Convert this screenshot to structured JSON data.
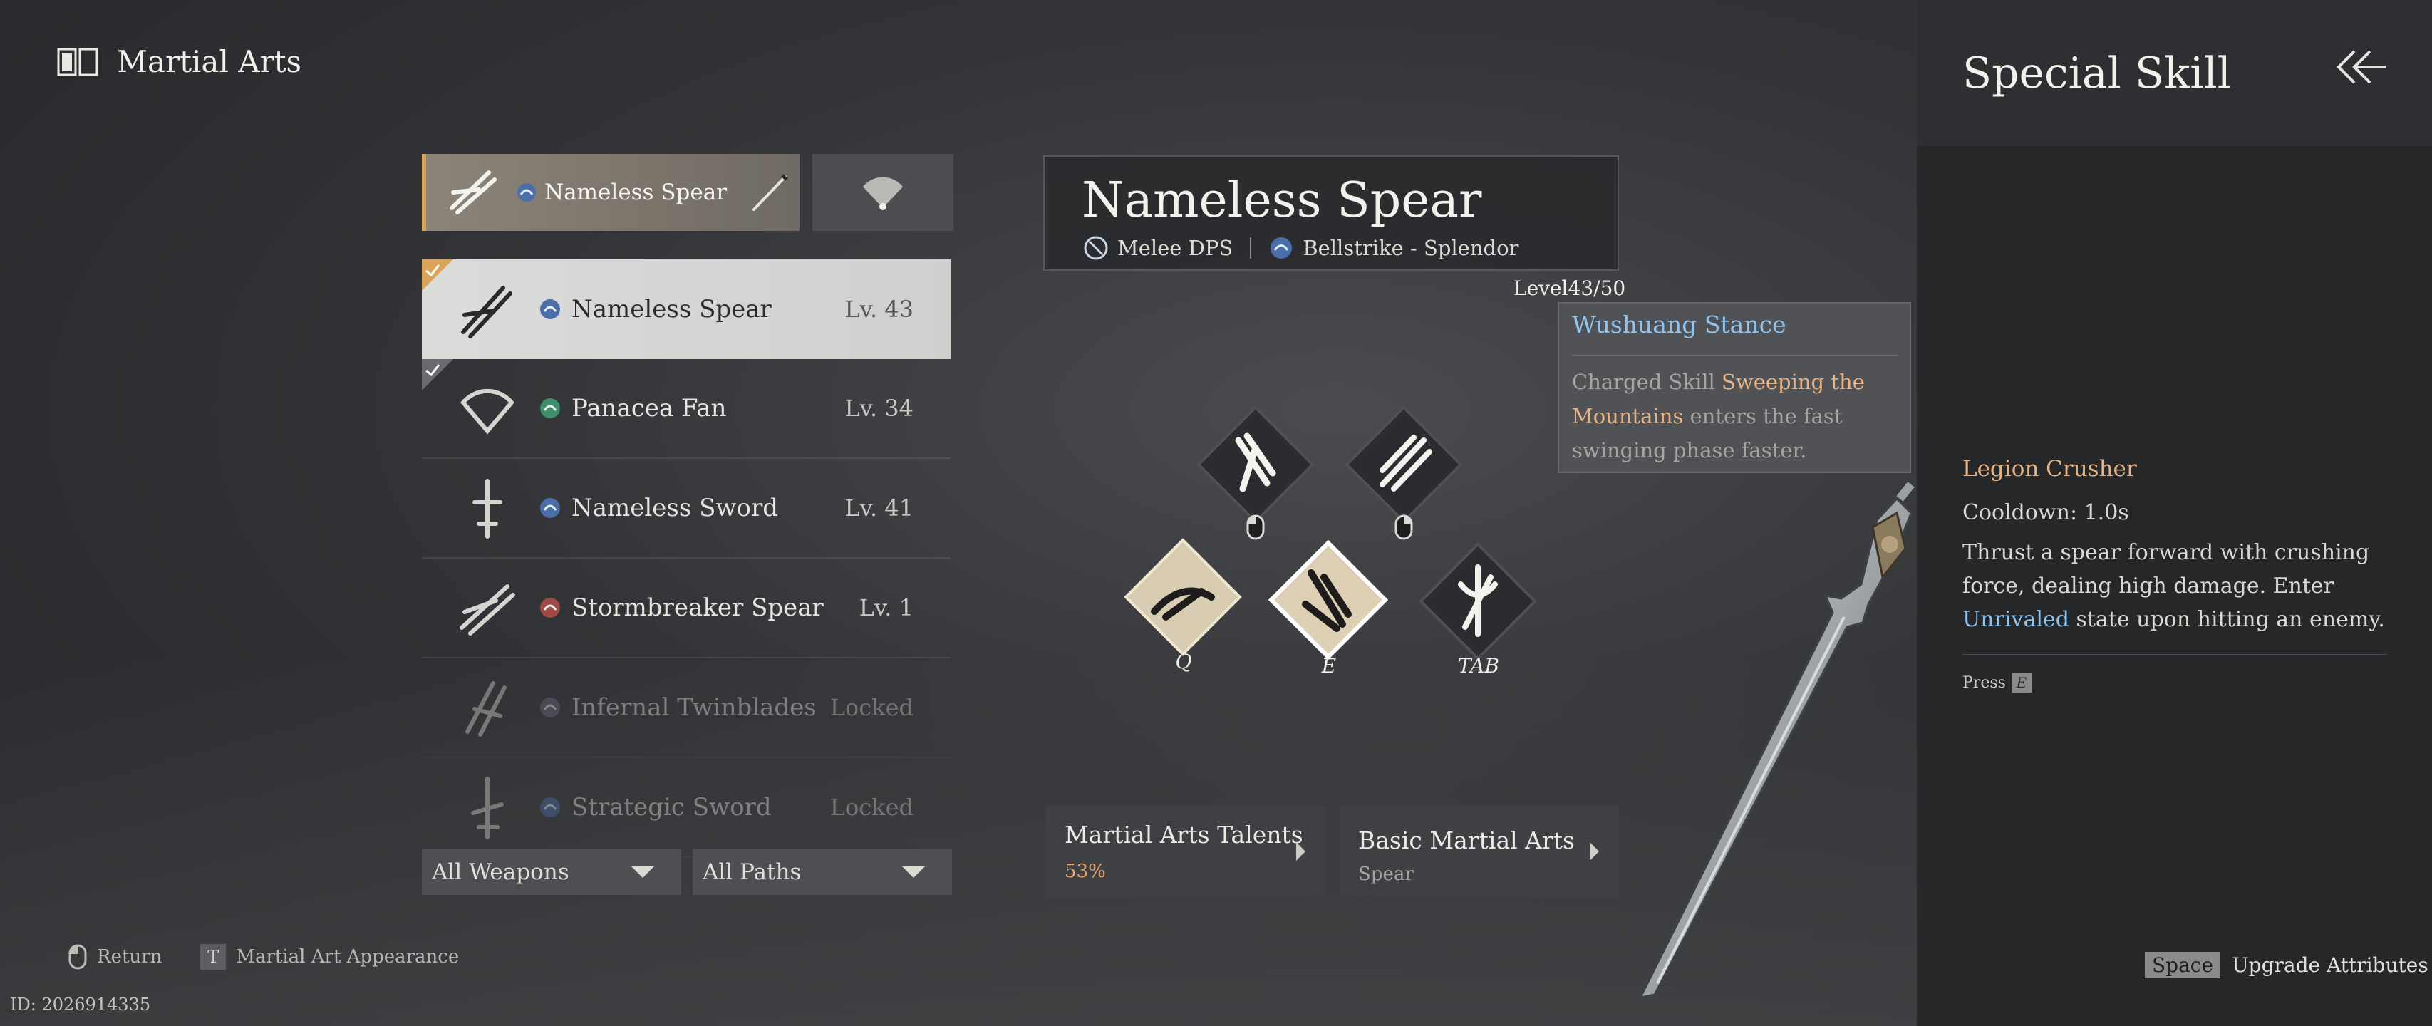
{
  "header": {
    "title": "Martial Arts",
    "icon": "book-icon"
  },
  "weapon_tabs": {
    "active": {
      "label": "Nameless Spear"
    }
  },
  "weapons": [
    {
      "name": "Nameless Spear",
      "level": "Lv. 43",
      "selected": true,
      "checked": true,
      "locked": false,
      "badge_color": "#4a6ea8"
    },
    {
      "name": "Panacea Fan",
      "level": "Lv. 34",
      "selected": false,
      "checked": true,
      "locked": false,
      "badge_color": "#3e8f6a"
    },
    {
      "name": "Nameless Sword",
      "level": "Lv. 41",
      "selected": false,
      "checked": false,
      "locked": false,
      "badge_color": "#4a6ea8"
    },
    {
      "name": "Stormbreaker Spear",
      "level": "Lv. 1",
      "selected": false,
      "checked": false,
      "locked": false,
      "badge_color": "#a04a44"
    },
    {
      "name": "Infernal Twinblades",
      "level": "Locked",
      "selected": false,
      "checked": false,
      "locked": true,
      "badge_color": "#6a6a80"
    },
    {
      "name": "Strategic Sword",
      "level": "Locked",
      "selected": false,
      "checked": false,
      "locked": true,
      "badge_color": "#4a6ea8"
    }
  ],
  "filters": {
    "weapons": "All Weapons",
    "paths": "All Paths"
  },
  "footer": {
    "return_label": "Return",
    "appearance_key": "T",
    "appearance_label": "Martial Art Appearance",
    "id": "ID: 2026914335"
  },
  "info": {
    "title": "Nameless Spear",
    "role": "Melee DPS",
    "path": "Bellstrike - Splendor",
    "level": "Level43/50"
  },
  "tooltip": {
    "title": "Wushuang Stance",
    "body_prefix": "Charged Skill ",
    "body_highlight": "Sweeping the Mountains",
    "body_suffix": " enters the fast swinging phase faster."
  },
  "skills": {
    "q": "Q",
    "e": "E",
    "tab": "TAB"
  },
  "cards": {
    "talents": {
      "title": "Martial Arts Talents",
      "sub": "53%"
    },
    "basic": {
      "title": "Basic Martial Arts",
      "sub": "Spear"
    }
  },
  "right_panel": {
    "title": "Special Skill",
    "skill_name": "Legion Crusher",
    "cooldown": "Cooldown: 1.0s",
    "desc_prefix": "Thrust a spear forward with crushing force, dealing high damage. Enter ",
    "desc_highlight": "Unrivaled",
    "desc_suffix": " state upon hitting an enemy.",
    "press_label": "Press",
    "press_key": "E",
    "upgrade_key": "Space",
    "upgrade_label": "Upgrade Attributes"
  },
  "colors": {
    "accent": "#d9a45a",
    "highlight_orange": "#e9b383",
    "highlight_blue": "#8fc4ef"
  }
}
